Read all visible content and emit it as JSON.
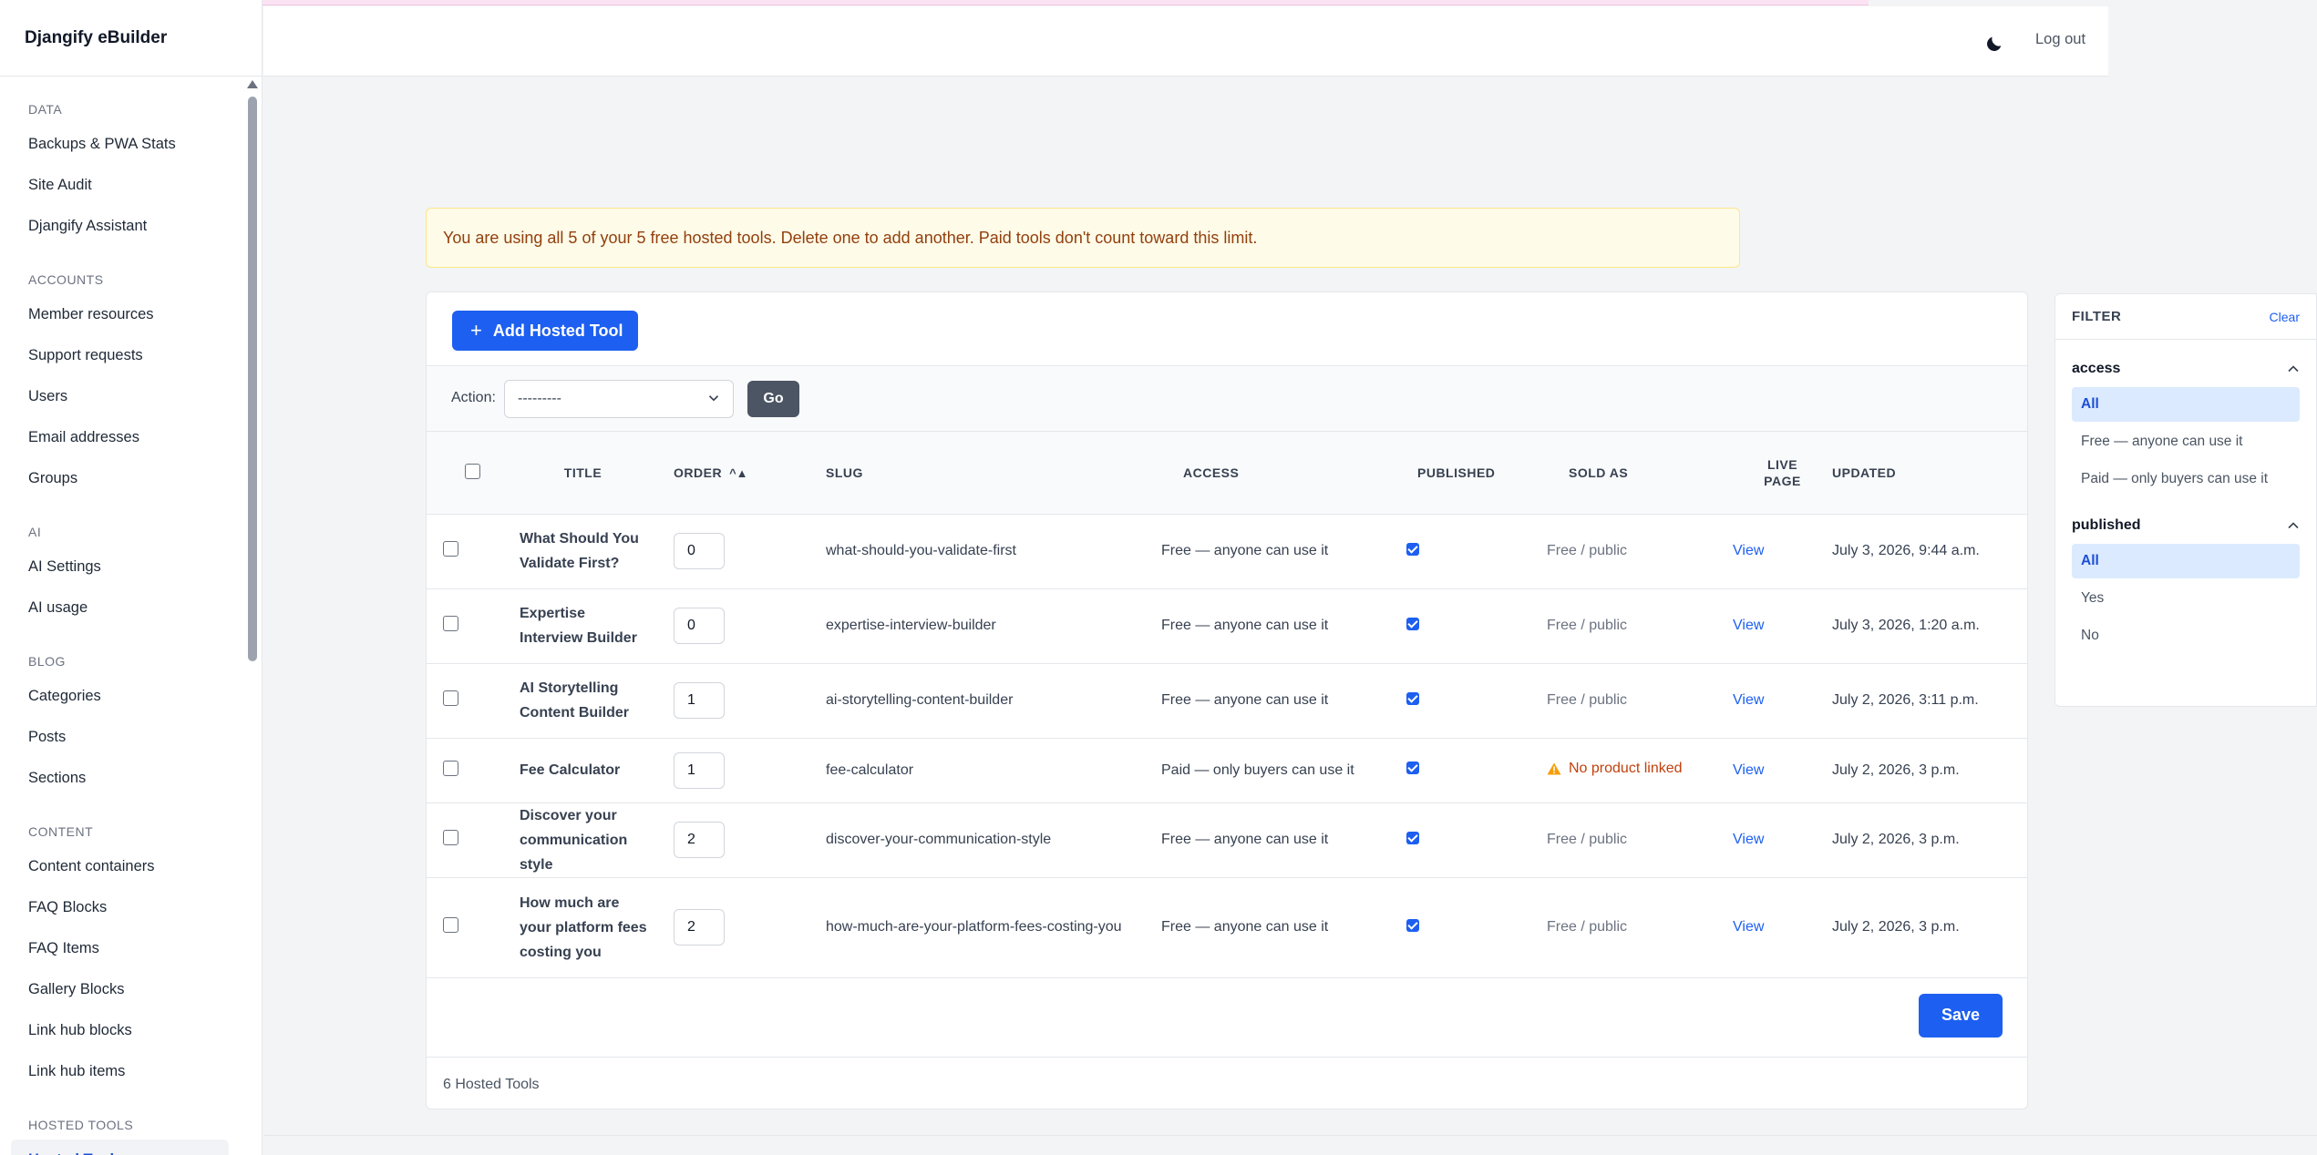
{
  "brand": "Djangify eBuilder",
  "header": {
    "logout": "Log out"
  },
  "sidebar": {
    "sections": [
      {
        "title": "DATA",
        "items": [
          "Backups & PWA Stats",
          "Site Audit",
          "Djangify Assistant"
        ]
      },
      {
        "title": "ACCOUNTS",
        "items": [
          "Member resources",
          "Support requests",
          "Users",
          "Email addresses",
          "Groups"
        ]
      },
      {
        "title": "AI",
        "items": [
          "AI Settings",
          "AI usage"
        ]
      },
      {
        "title": "BLOG",
        "items": [
          "Categories",
          "Posts",
          "Sections"
        ]
      },
      {
        "title": "CONTENT",
        "items": [
          "Content containers",
          "FAQ Blocks",
          "FAQ Items",
          "Gallery Blocks",
          "Link hub blocks",
          "Link hub items"
        ]
      },
      {
        "title": "HOSTED TOOLS",
        "items": [
          "Hosted Tools"
        ]
      }
    ],
    "active": "Hosted Tools"
  },
  "alert": "You are using all 5 of your 5 free hosted tools. Delete one to add another. Paid tools don't count toward this limit.",
  "toolbar": {
    "add_label": "Add Hosted Tool",
    "action_label": "Action:",
    "action_value": "---------",
    "go_label": "Go"
  },
  "table": {
    "columns": {
      "title": "TITLE",
      "order": "ORDER",
      "slug": "SLUG",
      "access": "ACCESS",
      "published": "PUBLISHED",
      "sold_as": "SOLD AS",
      "live_page": "LIVE PAGE",
      "updated": "UPDATED"
    },
    "rows": [
      {
        "title": "What Should You Validate First?",
        "order": "0",
        "slug": "what-should-you-validate-first",
        "access": "Free — anyone can use it",
        "published": true,
        "sold_as": "Free / public",
        "sold_as_warning": false,
        "live": "View",
        "updated": "July 3, 2026, 9:44 a.m."
      },
      {
        "title": "Expertise Interview Builder",
        "order": "0",
        "slug": "expertise-interview-builder",
        "access": "Free — anyone can use it",
        "published": true,
        "sold_as": "Free / public",
        "sold_as_warning": false,
        "live": "View",
        "updated": "July 3, 2026, 1:20 a.m."
      },
      {
        "title": "AI Storytelling Content Builder",
        "order": "1",
        "slug": "ai-storytelling-content-builder",
        "access": "Free — anyone can use it",
        "published": true,
        "sold_as": "Free / public",
        "sold_as_warning": false,
        "live": "View",
        "updated": "July 2, 2026, 3:11 p.m."
      },
      {
        "title": "Fee Calculator",
        "order": "1",
        "slug": "fee-calculator",
        "access": "Paid — only buyers can use it",
        "published": true,
        "sold_as": "No product linked",
        "sold_as_warning": true,
        "live": "View",
        "updated": "July 2, 2026, 3 p.m."
      },
      {
        "title": "Discover your communication style",
        "order": "2",
        "slug": "discover-your-communication-style",
        "access": "Free — anyone can use it",
        "published": true,
        "sold_as": "Free / public",
        "sold_as_warning": false,
        "live": "View",
        "updated": "July 2, 2026, 3 p.m."
      },
      {
        "title": "How much are your platform fees costing you",
        "order": "2",
        "slug": "how-much-are-your-platform-fees-costing-you",
        "access": "Free — anyone can use it",
        "published": true,
        "sold_as": "Free / public",
        "sold_as_warning": false,
        "live": "View",
        "updated": "July 2, 2026, 3 p.m."
      }
    ]
  },
  "save_label": "Save",
  "count": "6 Hosted Tools",
  "filter": {
    "title": "FILTER",
    "clear": "Clear",
    "groups": [
      {
        "name": "access",
        "options": [
          "All",
          "Free — anyone can use it",
          "Paid — only buyers can use it"
        ],
        "selected": "All"
      },
      {
        "name": "published",
        "options": [
          "All",
          "Yes",
          "No"
        ],
        "selected": "All"
      }
    ]
  },
  "colors": {
    "accent": "#1d5ff0",
    "warning": "#c2410c",
    "alert_bg": "#fefbe8"
  }
}
